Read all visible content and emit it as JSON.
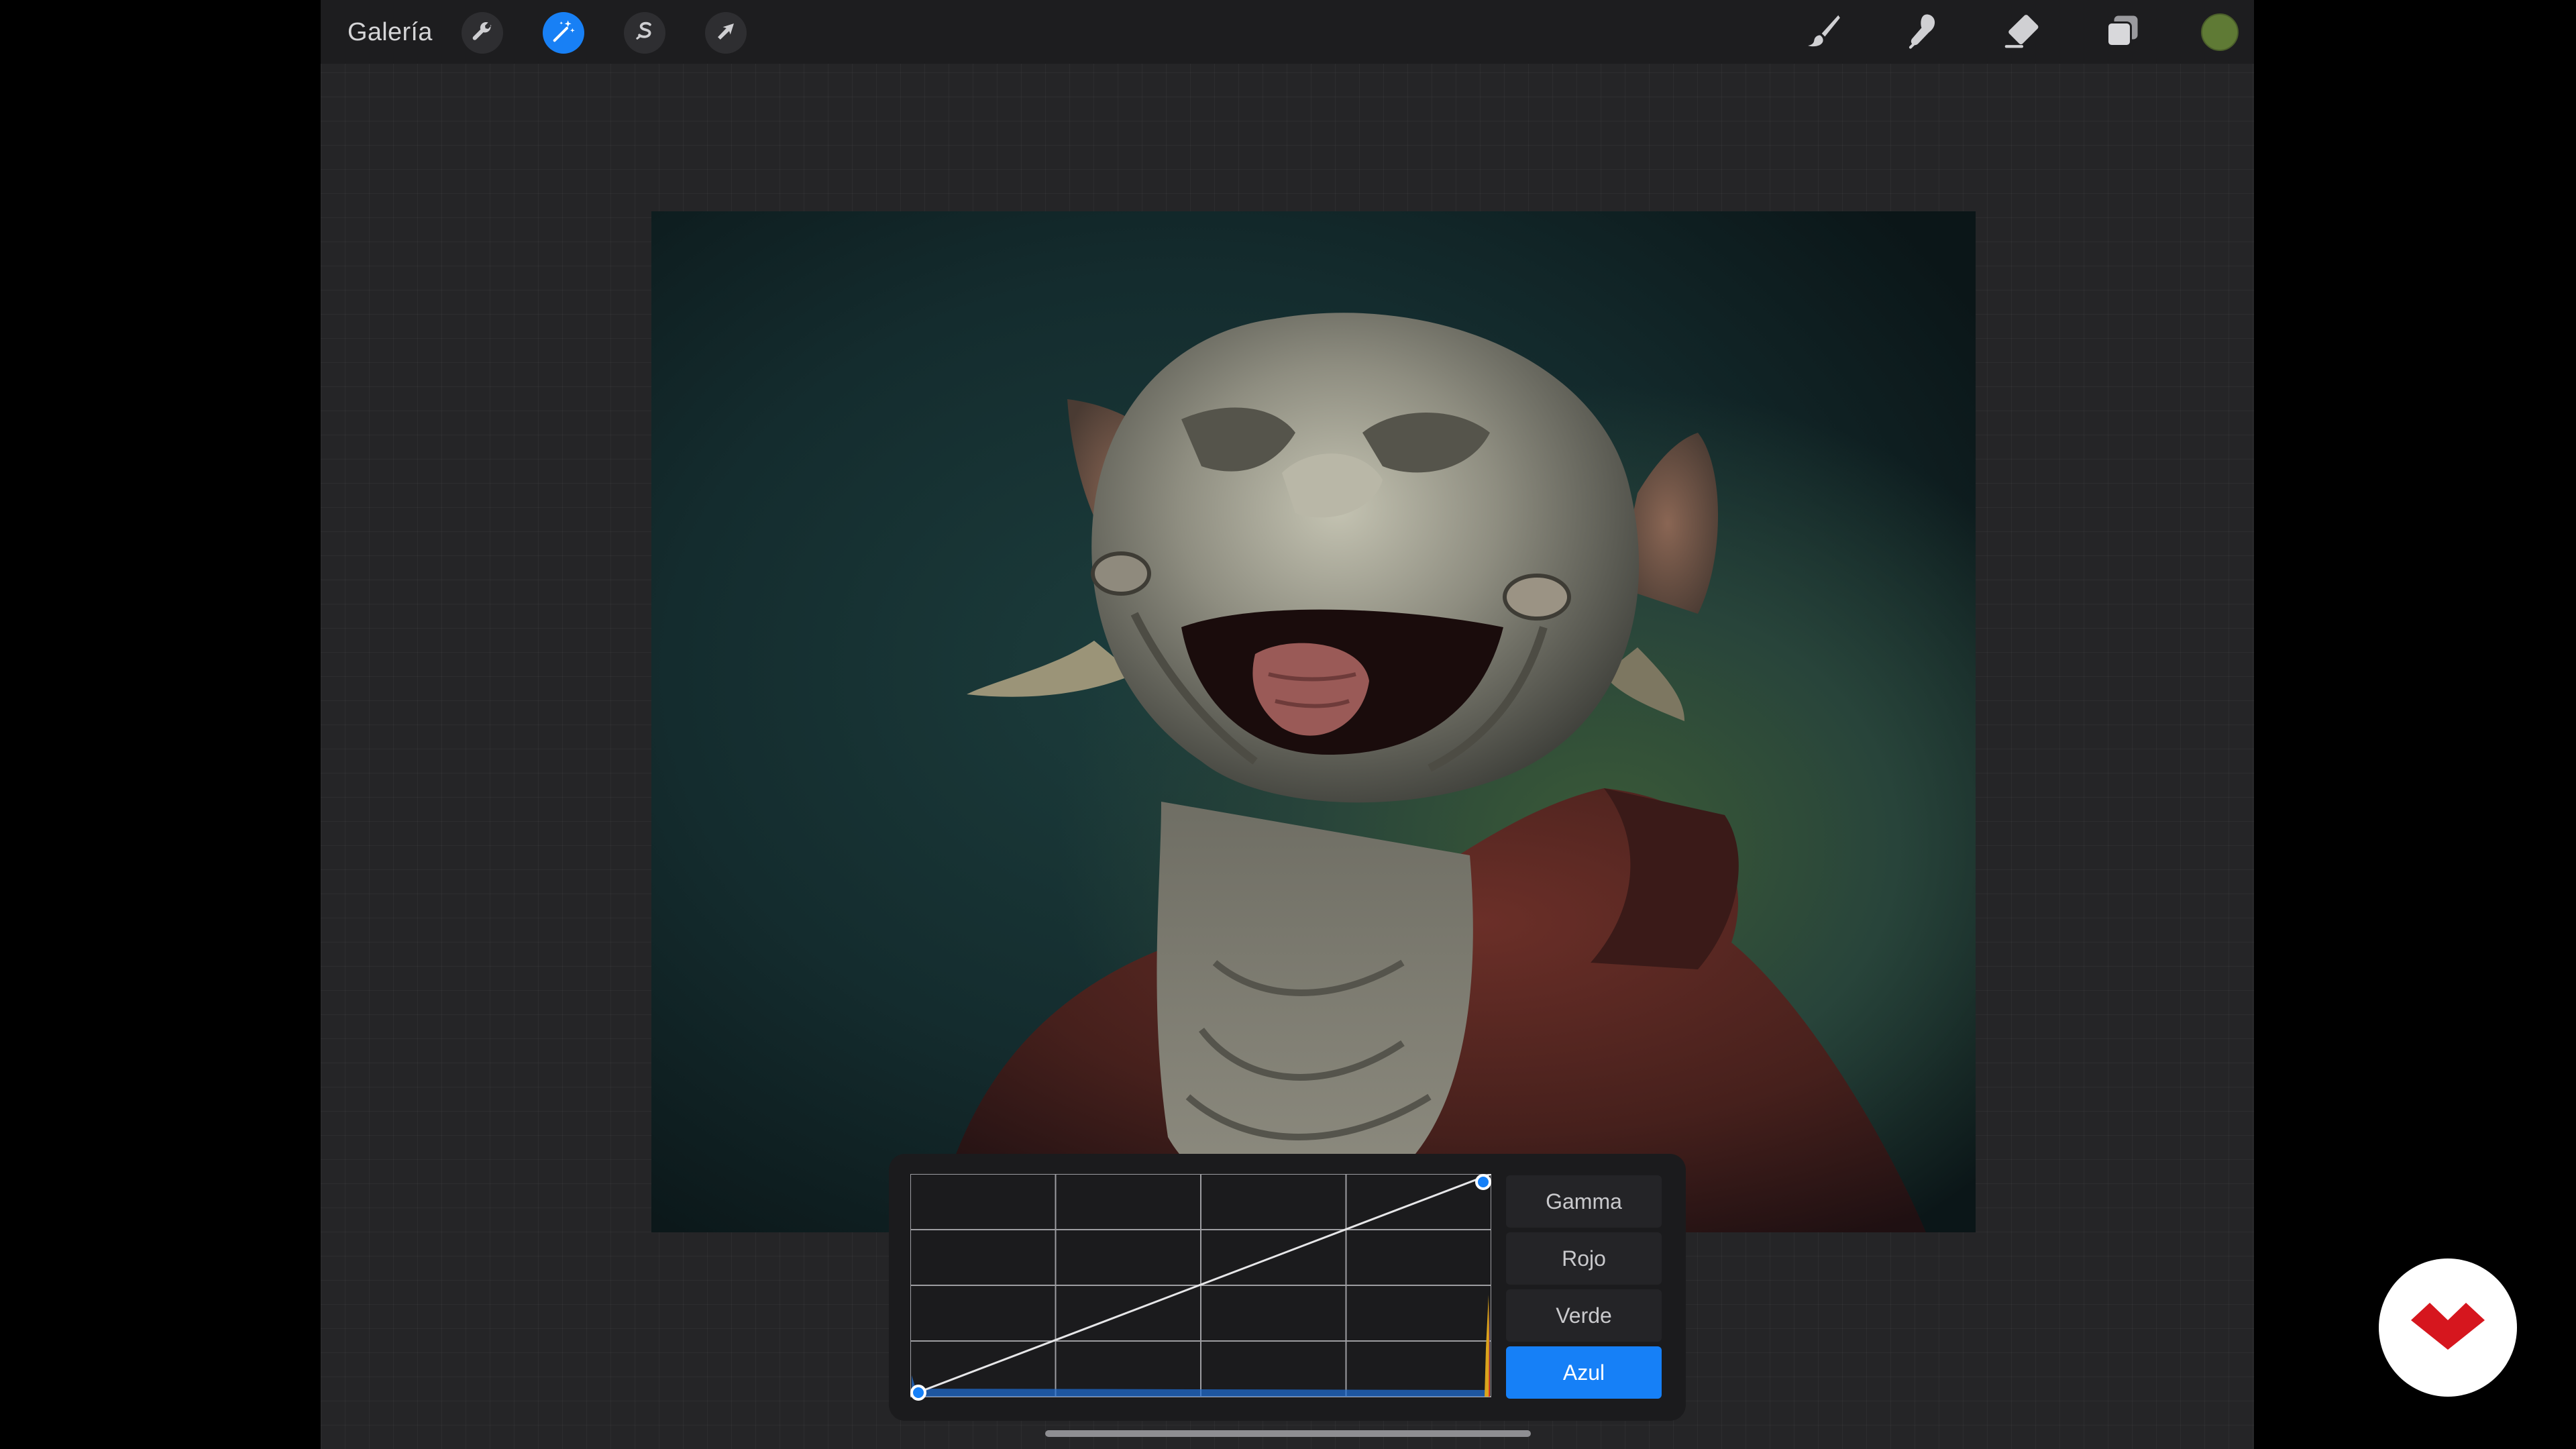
{
  "app": {
    "gallery_label": "Galería"
  },
  "toolbar": {
    "left_tools": [
      {
        "name": "actions",
        "icon": "wrench-icon"
      },
      {
        "name": "adjustments",
        "icon": "magic-wand-icon",
        "active": true
      },
      {
        "name": "selection",
        "icon": "selection-s-icon"
      },
      {
        "name": "transform",
        "icon": "arrow-cursor-icon"
      }
    ],
    "right_tools": [
      {
        "name": "brush",
        "icon": "brush-icon"
      },
      {
        "name": "smudge",
        "icon": "smudge-finger-icon"
      },
      {
        "name": "eraser",
        "icon": "eraser-icon"
      },
      {
        "name": "layers",
        "icon": "layers-icon"
      }
    ],
    "current_color": "#5f7a35",
    "active_color": "#1880f5"
  },
  "canvas": {
    "artwork": "creature-portrait"
  },
  "curves": {
    "active_channel": "Azul",
    "channels": [
      {
        "label": "Gamma",
        "active": false
      },
      {
        "label": "Rojo",
        "active": false
      },
      {
        "label": "Verde",
        "active": false
      },
      {
        "label": "Azul",
        "active": true
      }
    ],
    "curve_points": [
      [
        0,
        0
      ],
      [
        1,
        1
      ]
    ],
    "grid_divisions": 4,
    "accent_color": "#1680f7"
  },
  "watermark": {
    "logo": "red-chevron-logo"
  }
}
